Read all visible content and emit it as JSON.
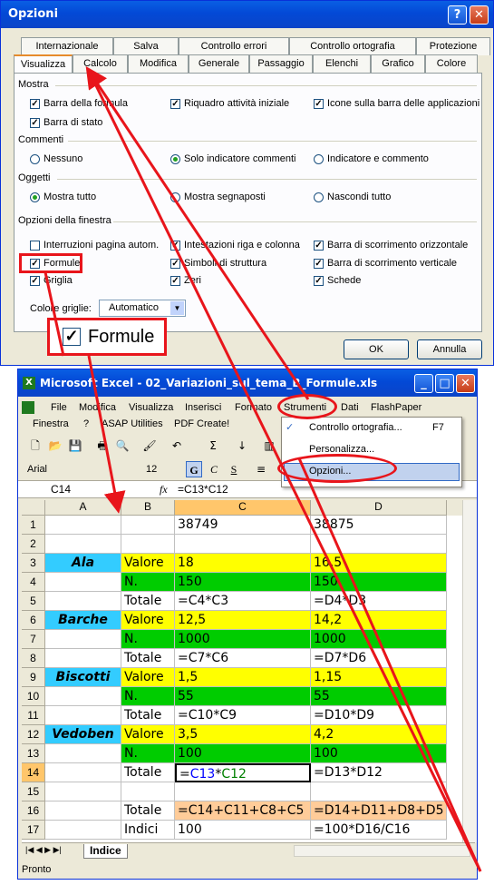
{
  "dialog": {
    "title": "Opzioni",
    "tabs_row1": [
      "Internazionale",
      "Salva",
      "Controllo errori",
      "Controllo ortografia",
      "Protezione"
    ],
    "tabs_row2": [
      "Visualizza",
      "Calcolo",
      "Modifica",
      "Generale",
      "Passaggio",
      "Elenchi",
      "Grafico",
      "Colore"
    ],
    "groups": {
      "mostra": "Mostra",
      "commenti": "Commenti",
      "oggetti": "Oggetti",
      "finestra": "Opzioni della finestra"
    },
    "mostra": {
      "barra_formula": "Barra della formula",
      "barra_stato": "Barra di stato",
      "riquadro": "Riquadro attività iniziale",
      "icone": "Icone sulla barra delle applicazioni"
    },
    "commenti": {
      "nessuno": "Nessuno",
      "solo": "Solo indicatore commenti",
      "indicatore": "Indicatore e commento"
    },
    "oggetti": {
      "tutto": "Mostra tutto",
      "segnaposti": "Mostra segnaposti",
      "nascondi": "Nascondi tutto"
    },
    "finestra": {
      "interruzioni": "Interruzioni pagina autom.",
      "formule": "Formule",
      "griglia": "Griglia",
      "intestazioni": "Intestazioni riga e colonna",
      "simboli": "Simboli di struttura",
      "zeri": "Zeri",
      "scorr_orizz": "Barra di scorrimento orizzontale",
      "scorr_vert": "Barra di scorrimento verticale",
      "schede": "Schede"
    },
    "colore_griglie_label": "Colore griglie:",
    "colore_griglie_value": "Automatico",
    "callout": "Formule",
    "ok": "OK",
    "annulla": "Annulla"
  },
  "excel": {
    "title": "Microsoft Excel - 02_Variazioni_sul_tema_B_Formule.xls",
    "menu1": [
      "File",
      "Modifica",
      "Visualizza",
      "Inserisci",
      "Formato",
      "Strumenti",
      "Dati",
      "FlashPaper"
    ],
    "menu2": [
      "Finestra",
      "?",
      "ASAP Utilities",
      "PDF Create!"
    ],
    "dropdown": {
      "item1": "Controllo ortografia...",
      "item1_key": "F7",
      "item2": "Personalizza...",
      "item3": "Opzioni..."
    },
    "font_name": "Arial",
    "font_size": "12",
    "name_box": "C14",
    "fx": "fx",
    "formula": "=C13*C12",
    "columns": [
      "A",
      "B",
      "C",
      "D"
    ],
    "rows": [
      {
        "n": "1",
        "a": "",
        "b": "",
        "c": "38749",
        "d": "38875"
      },
      {
        "n": "2",
        "a": "",
        "b": "",
        "c": "",
        "d": ""
      },
      {
        "n": "3",
        "a": "Ala",
        "b": "Valore",
        "c": "18",
        "d": "16,5"
      },
      {
        "n": "4",
        "a": "",
        "b": "N.",
        "c": "150",
        "d": "150"
      },
      {
        "n": "5",
        "a": "",
        "b": "Totale",
        "c": "=C4*C3",
        "d": "=D4*D3"
      },
      {
        "n": "6",
        "a": "Barche",
        "b": "Valore",
        "c": "12,5",
        "d": "14,2"
      },
      {
        "n": "7",
        "a": "",
        "b": "N.",
        "c": "1000",
        "d": "1000"
      },
      {
        "n": "8",
        "a": "",
        "b": "Totale",
        "c": "=C7*C6",
        "d": "=D7*D6"
      },
      {
        "n": "9",
        "a": "Biscotti",
        "b": "Valore",
        "c": "1,5",
        "d": "1,15"
      },
      {
        "n": "10",
        "a": "",
        "b": "N.",
        "c": "55",
        "d": "55"
      },
      {
        "n": "11",
        "a": "",
        "b": "Totale",
        "c": "=C10*C9",
        "d": "=D10*D9"
      },
      {
        "n": "12",
        "a": "Vedoben",
        "b": "Valore",
        "c": "3,5",
        "d": "4,2"
      },
      {
        "n": "13",
        "a": "",
        "b": "N.",
        "c": "100",
        "d": "100"
      },
      {
        "n": "14",
        "a": "",
        "b": "Totale",
        "c": "=C13*C12",
        "d": "=D13*D12"
      },
      {
        "n": "15",
        "a": "",
        "b": "",
        "c": "",
        "d": ""
      },
      {
        "n": "16",
        "a": "",
        "b": "Totale",
        "c": "=C14+C11+C8+C5",
        "d": "=D14+D11+D8+D5"
      },
      {
        "n": "17",
        "a": "",
        "b": "Indici",
        "c": "100",
        "d": "=100*D16/C16"
      }
    ],
    "sheet_tab": "Indice",
    "status": "Pronto",
    "colors": {
      "cyan": "#33ccff",
      "yellow": "#ffff00",
      "green": "#00cc00",
      "peach": "#ffcc99",
      "red": "#e8151b"
    }
  }
}
